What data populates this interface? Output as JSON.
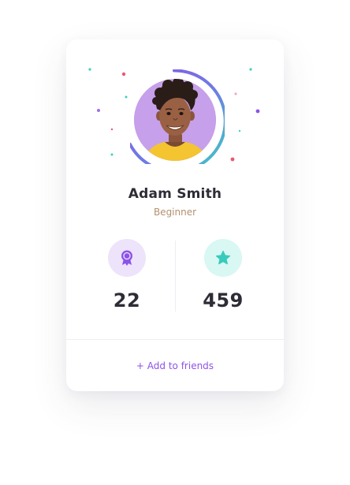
{
  "profile": {
    "name": "Adam Smith",
    "level": "Beginner"
  },
  "stats": [
    {
      "icon": "award-ribbon-icon",
      "value": "22",
      "badge_color": "#ede3fb",
      "icon_color": "#8b53e6"
    },
    {
      "icon": "star-icon",
      "value": "459",
      "badge_color": "#d9f7f3",
      "icon_color": "#38cbbb"
    }
  ],
  "actions": {
    "add_friends_label": "+ Add to friends"
  },
  "theme": {
    "accent_purple": "#8b53e6",
    "accent_teal": "#3ccfc0",
    "level_color": "#b4906d"
  }
}
